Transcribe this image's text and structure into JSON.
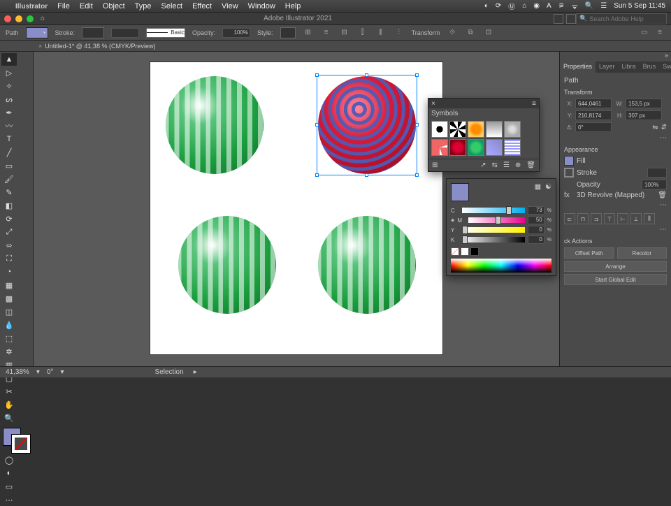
{
  "menubar": {
    "items": [
      "File",
      "Edit",
      "Object",
      "Type",
      "Select",
      "Effect",
      "View",
      "Window",
      "Help"
    ],
    "clock": "Sun 5 Sep  11:45"
  },
  "app_title": "Adobe Illustrator 2021",
  "search_placeholder": "Search Adobe Help",
  "control": {
    "path_label": "Path",
    "stroke_label": "Stroke:",
    "basic": "Basic",
    "opacity_label": "Opacity:",
    "opacity_val": "100%",
    "style_label": "Style:",
    "transform": "Transform"
  },
  "doc_tab": "Untitled-1* @ 41,38 % (CMYK/Preview)",
  "symbols_panel": {
    "title": "Symbols"
  },
  "color": {
    "c_label": "C",
    "m_label": "M",
    "y_label": "Y",
    "k_label": "K",
    "c": "73",
    "m": "50",
    "y": "0",
    "k": "0"
  },
  "props": {
    "tabs": [
      "Properties",
      "Layer",
      "Libra",
      "Brus",
      "Swat"
    ],
    "path": "Path",
    "transform_h": "Transform",
    "x_l": "X:",
    "x": "644,0461",
    "w_l": "W:",
    "w": "153,5 px",
    "y_l": "Y:",
    "y": "210,8174",
    "h_l": "H:",
    "h": "307 px",
    "rot_l": "Δ:",
    "rot": "0°",
    "appearance_h": "Appearance",
    "fill": "Fill",
    "stroke": "Stroke",
    "opacity": "Opacity",
    "opacity_v": "100%",
    "effect": "3D Revolve (Mapped)",
    "quick_h": "ck Actions",
    "offset": "Offset Path",
    "recolor": "Recolor",
    "arrange": "Arrange",
    "edit": "Start Global Edit"
  },
  "status": {
    "zoom": "41,38%",
    "rot": "0°",
    "sel": "Selection"
  }
}
